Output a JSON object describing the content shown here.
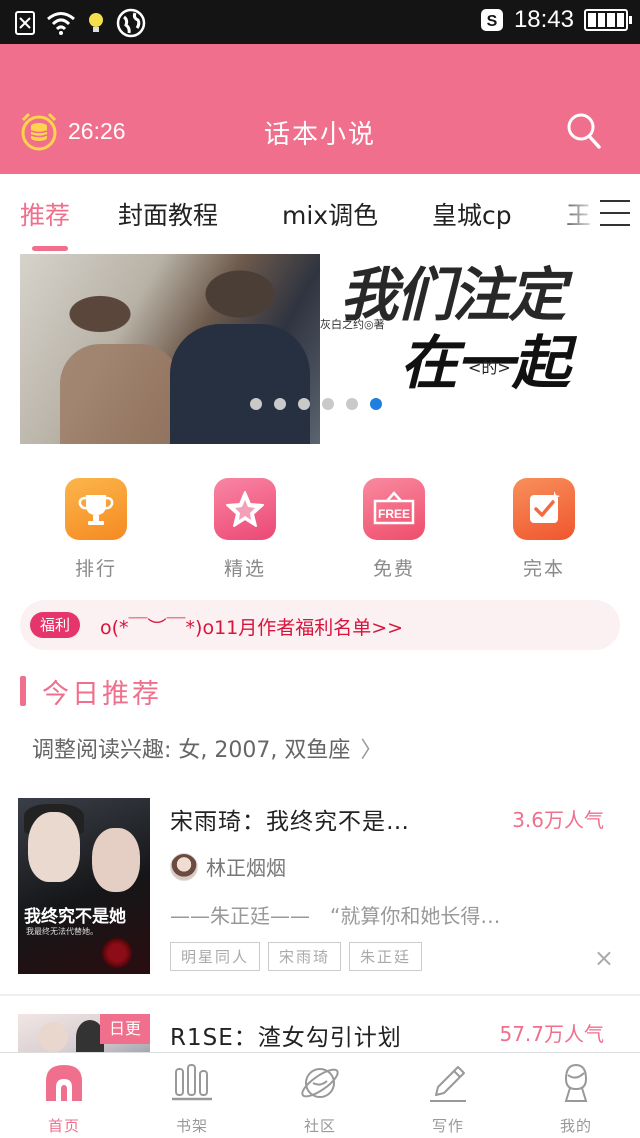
{
  "status_bar": {
    "time": "18:43",
    "icons": [
      "sim-off-icon",
      "wifi-icon",
      "bulb-icon",
      "globe-icon",
      "sogou-icon",
      "battery-icon"
    ]
  },
  "header": {
    "timer": "26:26",
    "title": "话本小说",
    "search_icon": "search-icon",
    "timer_icon": "alarm-coin-icon"
  },
  "tabs": [
    {
      "label": "推荐",
      "active": true
    },
    {
      "label": "封面教程"
    },
    {
      "label": "mix调色"
    },
    {
      "label": "皇城cp"
    },
    {
      "label": "王"
    }
  ],
  "banner": {
    "title_line1": "我们注定",
    "title_line2": "在一起",
    "de": "<的>",
    "author": "灰白之约◎著",
    "slide_count": 6,
    "active_slide": 6
  },
  "categories": [
    {
      "label": "排行",
      "icon": "trophy-icon",
      "color": "#f7952e"
    },
    {
      "label": "精选",
      "icon": "star-icon",
      "color": "#f0547f"
    },
    {
      "label": "免费",
      "icon": "free-icon",
      "color": "#f25d78",
      "icon_text": "FREE"
    },
    {
      "label": "完本",
      "icon": "check-icon",
      "color": "#f36a3e"
    }
  ],
  "notice": {
    "badge": "福利",
    "text": "o(*￣︶￣*)o11月作者福利名单>>"
  },
  "section": {
    "title": "今日推荐",
    "subtitle": "调整阅读兴趣: 女, 2007, 双鱼座",
    "chevron": "〉"
  },
  "books": [
    {
      "title": "宋雨琦：我终究不是…",
      "popularity": "3.6万人气",
      "author": "林正烟烟",
      "desc": "——朱正廷——　“就算你和她长得…",
      "tags": [
        "明星同人",
        "宋雨琦",
        "朱正廷"
      ],
      "cover_title": "我终究不是她",
      "cover_sub": "我最终无法代替她。",
      "close": "×"
    },
    {
      "title": "R1SE：渣女勾引计划",
      "popularity": "57.7万人气",
      "badge": "日更"
    }
  ],
  "bottom_nav": [
    {
      "label": "首页",
      "icon": "home-icon",
      "active": true
    },
    {
      "label": "书架",
      "icon": "bookshelf-icon"
    },
    {
      "label": "社区",
      "icon": "planet-icon"
    },
    {
      "label": "写作",
      "icon": "pen-icon"
    },
    {
      "label": "我的",
      "icon": "profile-icon"
    }
  ],
  "colors": {
    "brand": "#ef6f8c",
    "notice_text": "#d9143c",
    "dot_active": "#1e7fe0"
  }
}
